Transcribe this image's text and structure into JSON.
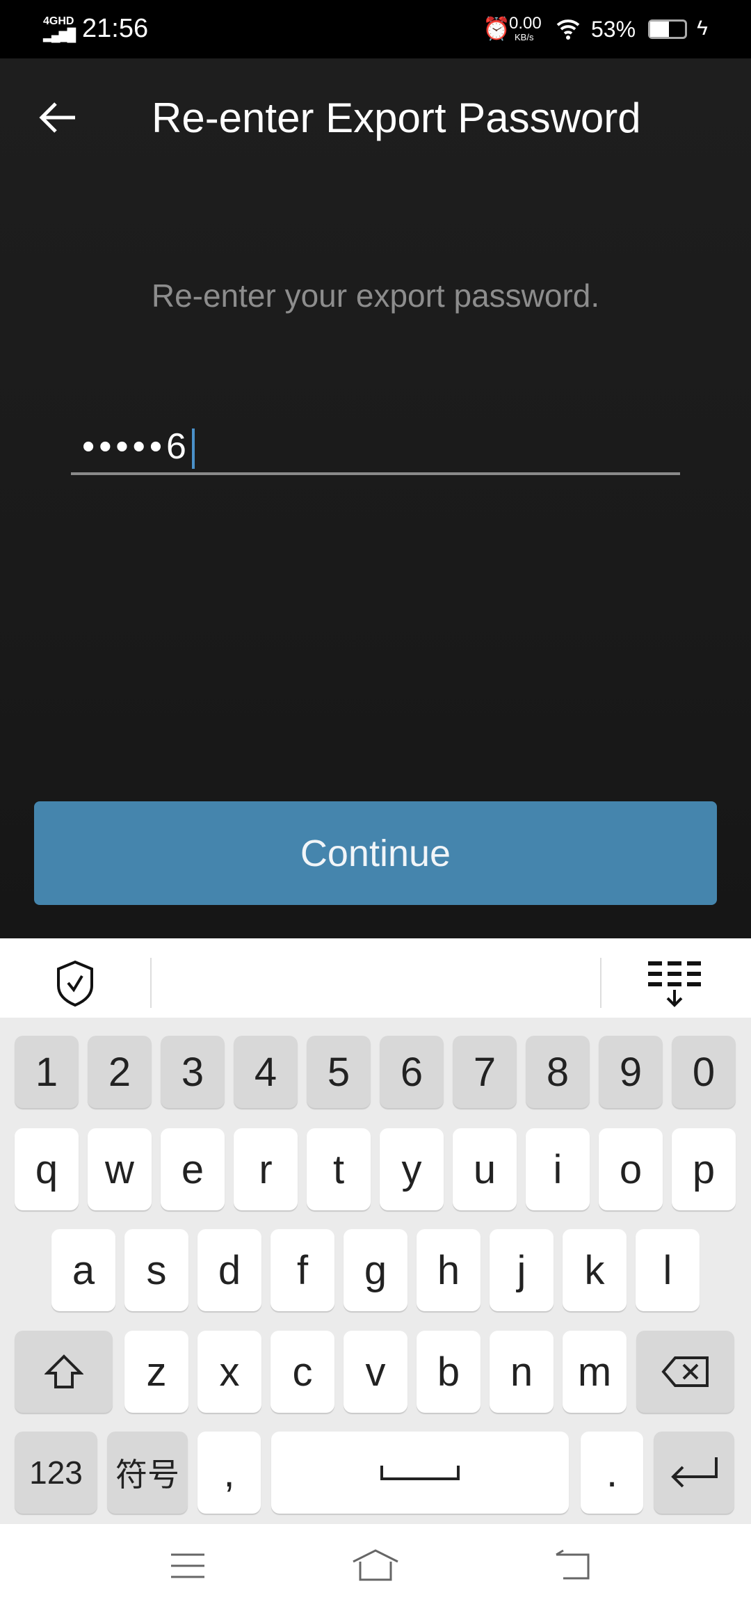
{
  "status": {
    "network": "4GHD",
    "time": "21:56",
    "speed": "0.00",
    "speed_unit": "KB/s",
    "battery": "53%"
  },
  "header": {
    "title": "Re-enter Export Password"
  },
  "main": {
    "instruction": "Re-enter your export password.",
    "password_value": "•••••6",
    "continue_label": "Continue"
  },
  "keyboard": {
    "rows": [
      [
        "1",
        "2",
        "3",
        "4",
        "5",
        "6",
        "7",
        "8",
        "9",
        "0"
      ],
      [
        "q",
        "w",
        "e",
        "r",
        "t",
        "y",
        "u",
        "i",
        "o",
        "p"
      ],
      [
        "a",
        "s",
        "d",
        "f",
        "g",
        "h",
        "j",
        "k",
        "l"
      ],
      [
        "z",
        "x",
        "c",
        "v",
        "b",
        "n",
        "m"
      ]
    ],
    "numbers_label": "123",
    "symbols_label": "符号",
    "comma": ",",
    "period": "."
  },
  "colors": {
    "accent": "#4585ad",
    "caret": "#4a90c8"
  }
}
